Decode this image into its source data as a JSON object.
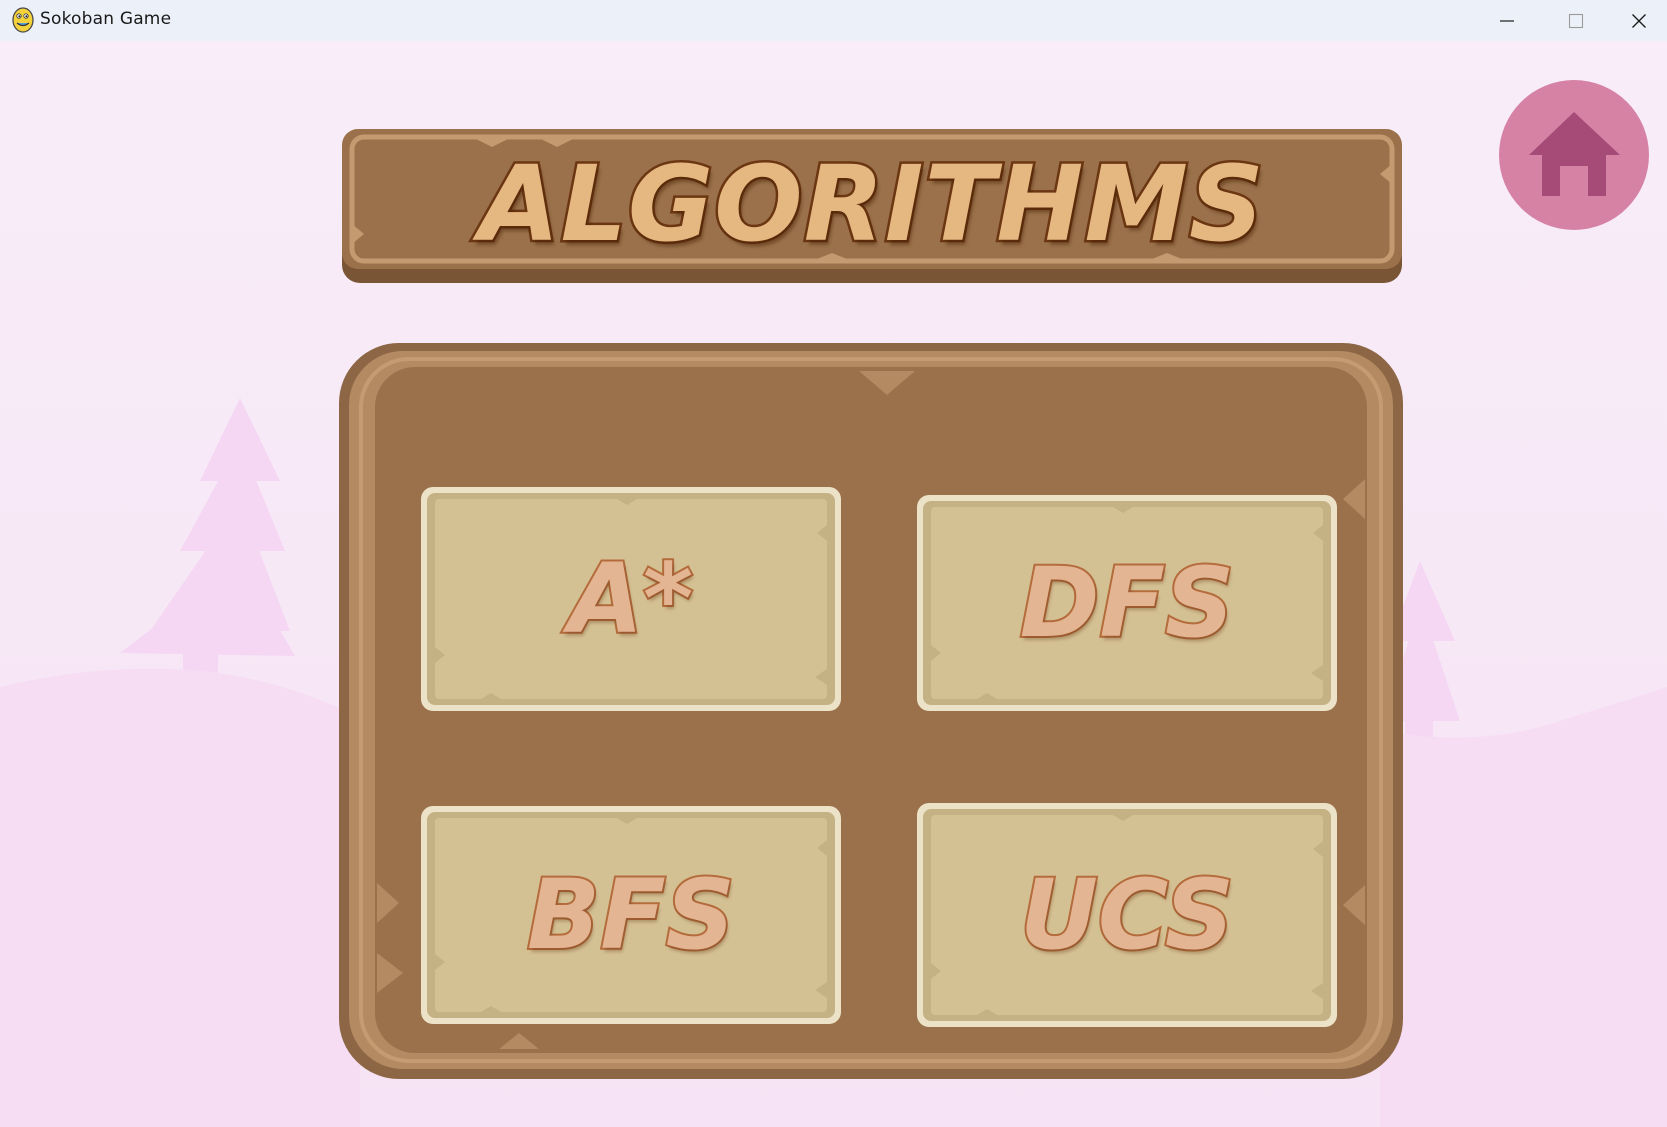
{
  "window": {
    "title": "Sokoban Game",
    "app_icon": "pygame-snake-icon",
    "controls": {
      "minimize_icon": "minimize-icon",
      "maximize_icon": "maximize-icon",
      "close_icon": "close-icon"
    }
  },
  "screen": {
    "heading": "ALGORITHMS",
    "home_icon": "home-icon",
    "algorithms": [
      {
        "label": "A*"
      },
      {
        "label": "DFS"
      },
      {
        "label": "BFS"
      },
      {
        "label": "UCS"
      }
    ]
  },
  "colors": {
    "background": "#f7eaf7",
    "hills": "#f6dff5",
    "trees": "#f5d8f3",
    "wood": "#9a714a",
    "wood_light": "#b68b63",
    "parchment": "#d4c193",
    "parchment_border": "#ece2c8",
    "heading_fill": "#e6b881",
    "heading_stroke": "#6b3611",
    "button_text": "#e4b592",
    "button_text_stroke": "#b56c3c",
    "home_circle": "#d682a5",
    "home_icon": "#a64a77"
  }
}
